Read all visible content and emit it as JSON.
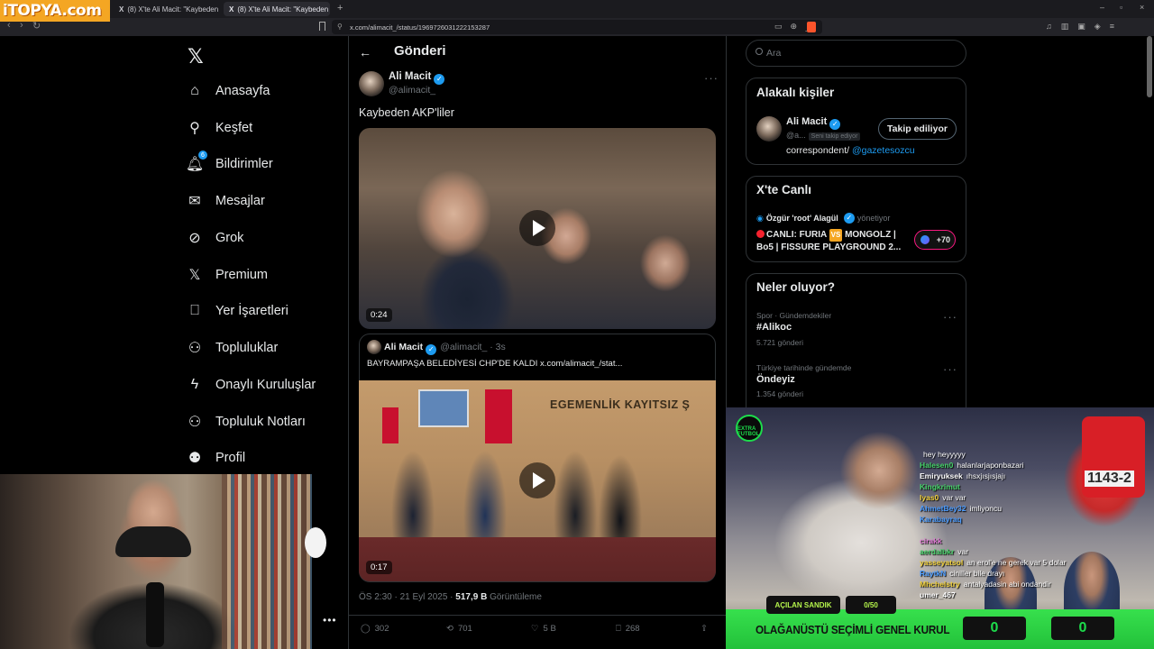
{
  "browser": {
    "logo": "iTOPYA.com",
    "tabs": [
      {
        "title": "(8) X'te Ali Macit: \"Kaybeden AKP'lile...",
        "active": false
      },
      {
        "title": "(8) X'te Ali Macit: \"Kaybeden AK...",
        "active": true
      }
    ],
    "url": "x.com/alimacit_/status/1969726031222153287"
  },
  "nav": {
    "items": [
      {
        "label": "Anasayfa",
        "icon": "home-icon"
      },
      {
        "label": "Keşfet",
        "icon": "search-icon"
      },
      {
        "label": "Bildirimler",
        "icon": "bell-icon",
        "badge": "6"
      },
      {
        "label": "Mesajlar",
        "icon": "mail-icon"
      },
      {
        "label": "Grok",
        "icon": "grok-icon"
      },
      {
        "label": "Premium",
        "icon": "x-logo-icon"
      },
      {
        "label": "Yer İşaretleri",
        "icon": "bookmark-icon"
      },
      {
        "label": "Topluluklar",
        "icon": "communities-icon"
      },
      {
        "label": "Onaylı Kuruluşlar",
        "icon": "lightning-icon"
      },
      {
        "label": "Topluluk Notları",
        "icon": "notes-icon"
      },
      {
        "label": "Profil",
        "icon": "person-icon"
      }
    ],
    "more": "•••"
  },
  "post": {
    "page_title": "Gönderi",
    "author_name": "Ali Macit",
    "author_handle": "@alimacit_",
    "text": "Kaybeden AKP'liler",
    "video_duration": "0:24",
    "quote": {
      "author_name": "Ali Macit",
      "author_handle": "@alimacit_ · 3s",
      "text": "BAYRAMPAŞA BELEDİYESİ CHP'DE KALDI  x.com/alimacit_/stat...",
      "wall_text": "EGEMENLİK KAYITSIZ Ş",
      "video_duration": "0:17"
    },
    "time": "ÖS 2:30 · 21 Eyl 2025 · ",
    "views_value": "517,9 B",
    "views_label": " Görüntüleme",
    "actions": {
      "replies": "302",
      "reposts": "701",
      "likes": "5 B",
      "bookmarks": "268"
    }
  },
  "sidebar": {
    "search_placeholder": "Ara",
    "related": {
      "title": "Alakalı kişiler",
      "name": "Ali Macit",
      "handle": "@a...",
      "follows_you": "Seni takip ediyor",
      "follow_button": "Takip ediliyor",
      "bio": "correspondent/ ",
      "bio_link": "@gazetesozcu"
    },
    "live": {
      "title": "X'te Canlı",
      "host": "Özgür 'root' Alagül",
      "role": "yönetiyor",
      "stream_title_a": "CANLI: FURIA ",
      "stream_vs": "VS",
      "stream_title_b": " MONGOLZ | Bo5 | FISSURE PLAYGROUND 2...",
      "listeners": "+70"
    },
    "trends": {
      "title": "Neler oluyor?",
      "items": [
        {
          "meta": "Spor · Gündemdekiler",
          "name": "#Alikoc",
          "count": "5.721 gönderi"
        },
        {
          "meta": "Türkiye tarihinde gündemde",
          "name": "Öndeyiz",
          "count": "1.354 gönderi"
        }
      ]
    }
  },
  "stream": {
    "logo": "EXTRA FUTBOL",
    "tag": "1143-2",
    "label_left": "AÇILAN SANDIK",
    "label_right": "0/50",
    "title": "OLAĞANÜSTÜ SEÇİMLİ GENEL KURUL",
    "score_left": "0",
    "score_right": "0",
    "chat": [
      {
        "user": "",
        "msg": "hey heyyyyy",
        "color": "#ffffff"
      },
      {
        "user": "Halesen0",
        "msg": "halanlarjaponbazari",
        "color": "#47d36a"
      },
      {
        "user": "Emiryuksek",
        "msg": "ıhsxjısjısjajı",
        "color": "#ffffff"
      },
      {
        "user": "Kingkrimut",
        "msg": "",
        "color": "#47d36a"
      },
      {
        "user": "lyas0",
        "msg": "var var",
        "color": "#f2d23c"
      },
      {
        "user": "AhmetBey32",
        "msg": "imliyoncu",
        "color": "#4b9cff"
      },
      {
        "user": "Karabayraq",
        "msg": "",
        "color": "#4b9cff"
      },
      {
        "user": "",
        "msg": "",
        "color": "#ffffff"
      },
      {
        "user": "cirakk",
        "msg": "",
        "color": "#e07ad6"
      },
      {
        "user": "aerdalbkr",
        "msg": "var",
        "color": "#47d36a"
      },
      {
        "user": "yasseyatsol",
        "msg": "an erol'e ne gerek var 5 dolar",
        "color": "#f2d23c"
      },
      {
        "user": "RaytkN",
        "msg": "ciniller bile drayı",
        "color": "#4b9cff"
      },
      {
        "user": "Mhchelstry",
        "msg": "antalyadasin abi ondandir",
        "color": "#f2d23c"
      },
      {
        "user": "umer_467",
        "msg": "",
        "color": "#ffffff"
      }
    ]
  }
}
